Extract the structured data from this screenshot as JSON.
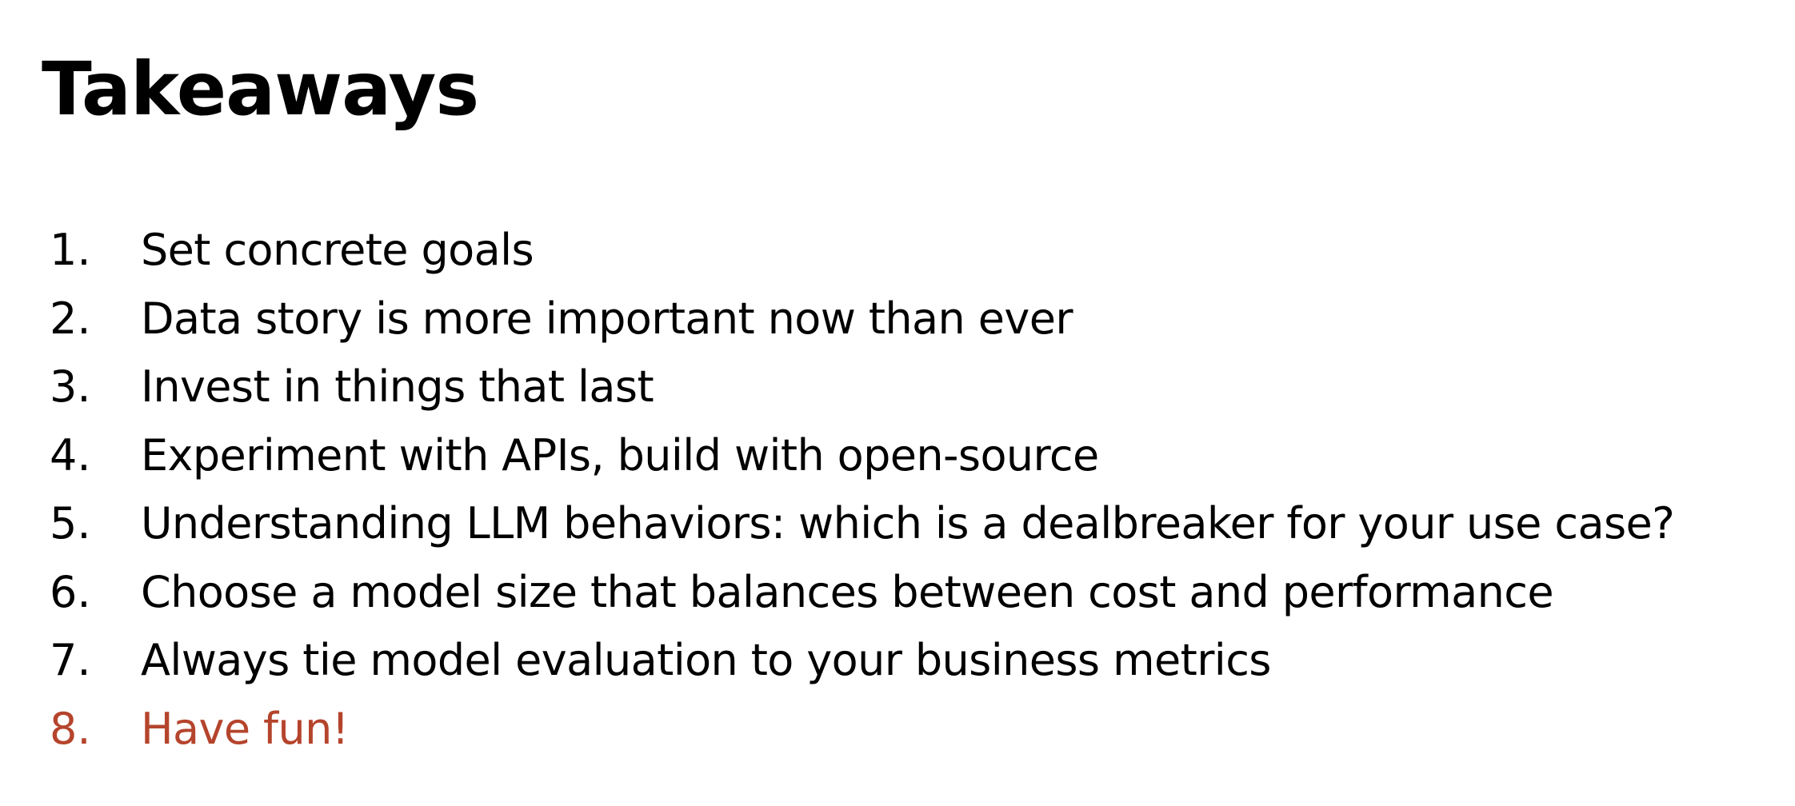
{
  "slide": {
    "title": "Takeaways",
    "items": [
      {
        "number": "1.",
        "text": "Set concrete goals",
        "color": "#000000"
      },
      {
        "number": "2.",
        "text": "Data story is more important now than ever",
        "color": "#000000"
      },
      {
        "number": "3.",
        "text": "Invest in things that last",
        "color": "#000000"
      },
      {
        "number": "4.",
        "text": "Experiment with APIs, build with open-source",
        "color": "#000000"
      },
      {
        "number": "5.",
        "text": "Understanding LLM behaviors: which is a dealbreaker for your use case?",
        "color": "#000000"
      },
      {
        "number": "6.",
        "text": "Choose a model size that balances between cost and performance",
        "color": "#000000"
      },
      {
        "number": "7.",
        "text": "Always tie model evaluation to your business metrics",
        "color": "#000000"
      },
      {
        "number": "8.",
        "text": "Have fun!",
        "color": "#b5442c"
      }
    ]
  }
}
